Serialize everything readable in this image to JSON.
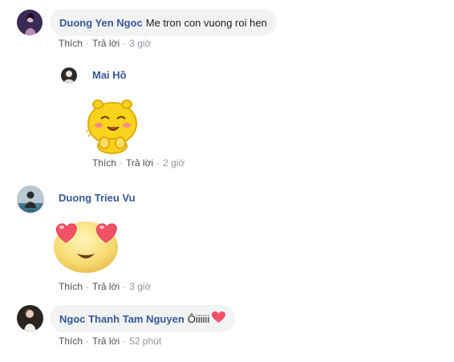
{
  "comments": [
    {
      "author": "Duong Yen Ngoc",
      "text": "Me tron con vuong roi hen",
      "like_label": "Thích",
      "reply_label": "Trả lời",
      "time": "3 giờ"
    },
    {
      "author": "Mai Hồ",
      "sticker": "happy-blob-sticker",
      "like_label": "Thích",
      "reply_label": "Trả lời",
      "time": "2 giờ"
    },
    {
      "author": "Duong Trieu Vu",
      "sticker": "heart-eyes-sticker",
      "like_label": "Thích",
      "reply_label": "Trả lời",
      "time": "3 giờ"
    },
    {
      "author": "Ngoc Thanh Tam Nguyen",
      "text": "Ôiiiiii",
      "emoji": "heart-icon",
      "like_label": "Thích",
      "reply_label": "Trả lời",
      "time": "52 phút"
    }
  ],
  "colors": {
    "name": "#385898",
    "bubble": "#f2f3f5",
    "meta": "#90949c",
    "heart": "#f25268"
  }
}
